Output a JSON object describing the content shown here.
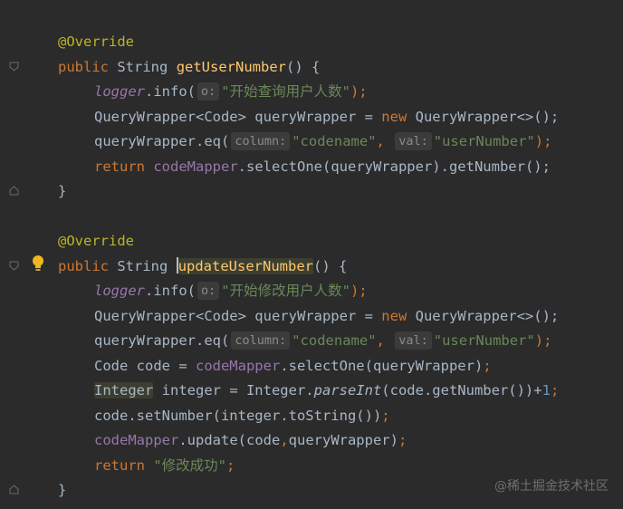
{
  "method1": {
    "annotation": "@Override",
    "kw_public": "public",
    "type": "String",
    "name": "getUserNumber",
    "params_open": "() {",
    "l1_field": "logger",
    "l1_call": ".info(",
    "l1_hint": "o:",
    "l1_str": "\"开始查询用户人数\"",
    "l1_end": ");",
    "l2_a": "QueryWrapper<Code> queryWrapper = ",
    "l2_new": "new",
    "l2_b": " QueryWrapper<>();",
    "l3_a": "queryWrapper.eq(",
    "l3_hint1": "column:",
    "l3_str1": "\"codename\"",
    "l3_comma": ",",
    "l3_hint2": "val:",
    "l3_str2": "\"userNumber\"",
    "l3_end": ");",
    "l4_kw": "return",
    "l4_field": "codeMapper",
    "l4_rest": ".selectOne(queryWrapper).getNumber();",
    "close": "}"
  },
  "method2": {
    "annotation": "@Override",
    "kw_public": "public",
    "type": "String",
    "name": "updateUserNumber",
    "params_open": "() {",
    "l1_field": "logger",
    "l1_call": ".info(",
    "l1_hint": "o:",
    "l1_str": "\"开始修改用户人数\"",
    "l1_end": ");",
    "l2_a": "QueryWrapper<Code> queryWrapper = ",
    "l2_new": "new",
    "l2_b": " QueryWrapper<>();",
    "l3_a": "queryWrapper.eq(",
    "l3_hint1": "column:",
    "l3_str1": "\"codename\"",
    "l3_comma": ",",
    "l3_hint2": "val:",
    "l3_str2": "\"userNumber\"",
    "l3_end": ");",
    "l4_a": "Code code = ",
    "l4_field": "codeMapper",
    "l4_rest": ".selectOne(queryWrapper)",
    "l4_end": ";",
    "l5_type": "Integer",
    "l5_a": " integer = Integer.",
    "l5_it": "parseInt",
    "l5_b": "(code.getNumber())+",
    "l5_num": "1",
    "l5_end": ";",
    "l6_a": "code.setNumber(integer.toString())",
    "l6_end": ";",
    "l7_field": "codeMapper",
    "l7_a": ".update(code",
    "l7_comma": ",",
    "l7_b": "queryWrapper)",
    "l7_end": ";",
    "l8_kw": "return",
    "l8_str": "\"修改成功\"",
    "l8_end": ";",
    "close": "}"
  },
  "watermark": "@稀土掘金技术社区"
}
